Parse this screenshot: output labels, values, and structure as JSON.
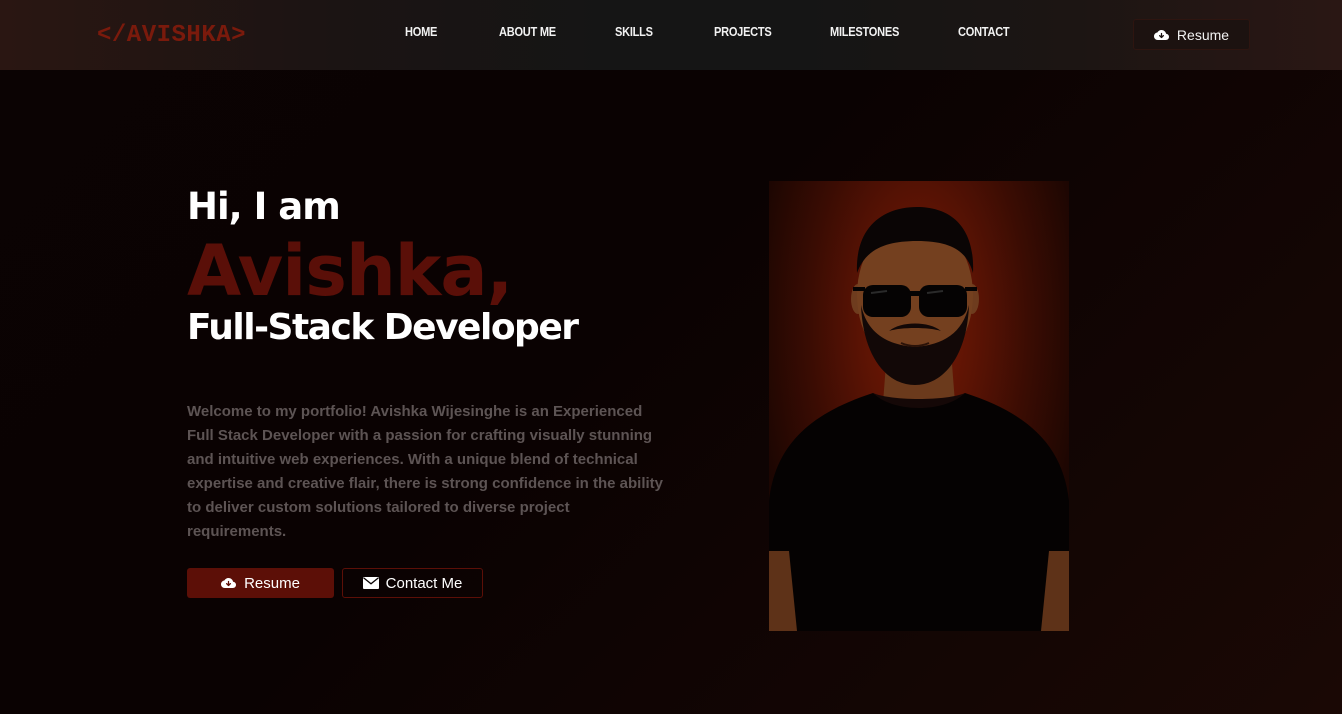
{
  "nav": {
    "logo": "</AVISHKA>",
    "links": [
      {
        "label": "HOME"
      },
      {
        "label": "ABOUT ME"
      },
      {
        "label": "SKILLS"
      },
      {
        "label": "PROJECTS"
      },
      {
        "label": "MILESTONES"
      },
      {
        "label": "CONTACT"
      }
    ],
    "resume_label": "Resume",
    "resume_icon": "cloud-download-icon"
  },
  "hero": {
    "greeting": "Hi, I am",
    "name": "Avishka,",
    "role": "Full-Stack Developer",
    "description": "Welcome to my portfolio! Avishka Wijesinghe is an Experienced Full Stack Developer with a passion for crafting visually stunning and intuitive web experiences. With a unique blend of technical expertise and creative flair, there is strong confidence in the ability to deliver custom solutions tailored to diverse project requirements.",
    "resume_button": "Resume",
    "resume_icon": "cloud-download-icon",
    "contact_button": "Contact Me",
    "contact_icon": "envelope-icon"
  },
  "colors": {
    "accent": "#5c0f07",
    "logo": "#7a1a0c",
    "background": "#0a0303",
    "nav_background": "#151515",
    "description_text": "#5d5454"
  }
}
